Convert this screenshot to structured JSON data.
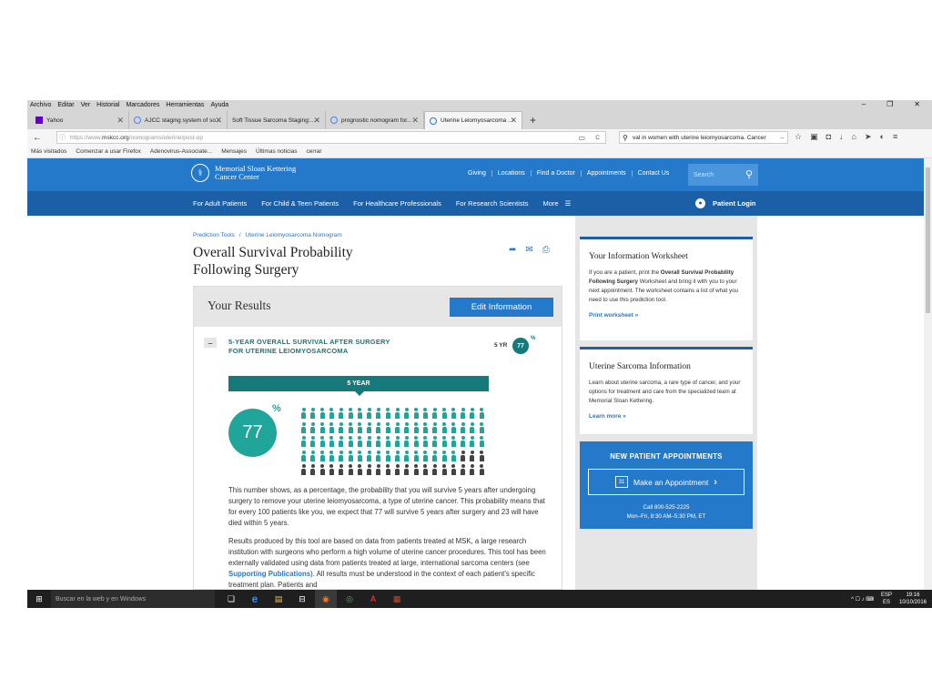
{
  "menubar": {
    "items": [
      "Archivo",
      "Editar",
      "Ver",
      "Historial",
      "Marcadores",
      "Herramientas",
      "Ayuda"
    ],
    "minimize": "–",
    "maximize": "❐",
    "close": "✕"
  },
  "tabs": [
    {
      "label": "Yahoo",
      "fav_color": "#6001d2"
    },
    {
      "label": "AJCC staging system of so...",
      "fav_color": "#4285f4"
    },
    {
      "label": "Soft Tissue Sarcoma Staging:...",
      "fav_color": "#cccccc"
    },
    {
      "label": "prognostic nomogram for...",
      "fav_color": "#4285f4"
    },
    {
      "label": "Uterine Leiomyosarcoma ...",
      "fav_color": "#2479cb"
    }
  ],
  "tab_close": "✕",
  "new_tab": "+",
  "nav": {
    "url_prefix": "https://www.",
    "url_domain": "mskcc.org",
    "url_path": "/nomograms/uterine/post-op",
    "search_text": "val in women with uterine leiomyosarcoma. Cancer",
    "back": "←",
    "info": "ⓘ",
    "lock": "🔒",
    "reload": "C",
    "reader": "▭",
    "go": "→",
    "icons": [
      "☆",
      "▣",
      "◘",
      "↓",
      "⌂",
      "➤",
      "◐",
      "≡"
    ]
  },
  "bookmarks": [
    "Más visitados",
    "Comenzar a usar Firefox",
    "Adenovirus-Associate...",
    "Mensajes",
    "Últimas noticias",
    "cerrar"
  ],
  "site": {
    "logo_line1": "Memorial Sloan Kettering",
    "logo_line2": "Cancer Center",
    "top_links": [
      "Giving",
      "Locations",
      "Find a Doctor",
      "Appointments",
      "Contact Us"
    ],
    "search_placeholder": "Search",
    "nav_links": [
      "For Adult Patients",
      "For Child & Teen Patients",
      "For Healthcare Professionals",
      "For Research Scientists",
      "More"
    ],
    "menu_icon": "☰",
    "login": "Patient Login"
  },
  "page": {
    "crumb1": "Prediction Tools",
    "crumb_sep": "/",
    "crumb2": "Uterine Leiomyosarcoma Nomogram",
    "title": "Overall Survival Probability Following Surgery",
    "share_icons": [
      "➦",
      "✉",
      "⎙"
    ]
  },
  "results": {
    "heading": "Your Results",
    "edit_label": "Edit Information",
    "collapse": "–",
    "section_title": "5-YEAR OVERALL SURVIVAL AFTER SURGERY FOR UTERINE LEIOMYOSARCOMA",
    "yr_label": "5 YR",
    "value": "77",
    "pct": "%",
    "year_bar": "5 YEAR",
    "survived_count": 77,
    "total_count": 100,
    "survived_color": "#20a59a",
    "died_color": "#444444",
    "para1": "This number shows, as a percentage, the probability that you will survive 5 years after undergoing surgery to remove your uterine leiomyosarcoma, a type of uterine cancer. This probability means that for every 100 patients like you, we expect that 77 will survive 5 years after surgery and 23 will have died within 5 years.",
    "para2_a": "Results produced by this tool are based on data from patients treated at MSK, a large research institution with surgeons who perform a high volume of uterine cancer procedures. This tool has been externally validated using data from patients treated at large, international sarcoma centers (see ",
    "para2_link": "Supporting Publications",
    "para2_b": "). All results must be understood in the context of each patient's specific treatment plan. Patients and"
  },
  "sidebar": {
    "ws_title": "Your Information Worksheet",
    "ws_text1": "If you are a patient, print the ",
    "ws_bold": "Overall Survival Probability Following Surgery",
    "ws_text2": " Worksheet and bring it with you to your next appointment. The worksheet contains a list of what you need to use this prediction tool.",
    "ws_link": "Print worksheet »",
    "info_title": "Uterine Sarcoma Information",
    "info_text": "Learn about uterine sarcoma, a rare type of cancer, and your options for treatment and care from the specialized team at Memorial Sloan Kettering.",
    "info_link": "Learn more »",
    "appt_heading": "NEW PATIENT APPOINTMENTS",
    "appt_cal": "31",
    "appt_button": "Make an Appointment",
    "appt_chevron": "›",
    "appt_phone": "Call 800-525-2225",
    "appt_hours": "Mon–Fri, 8:30 AM–5:30 PM, ET"
  },
  "taskbar": {
    "start": "⊞",
    "search_placeholder": "Buscar en la web y en Windows",
    "apps": [
      "❏",
      "e",
      "▤",
      "⊟",
      "◉",
      "◎",
      "A",
      "▦"
    ],
    "tray_icons": "^ ☐ ♪ ⌨",
    "lang1": "ESP",
    "lang2": "ES",
    "time": "19:16",
    "date": "10/10/2016"
  }
}
